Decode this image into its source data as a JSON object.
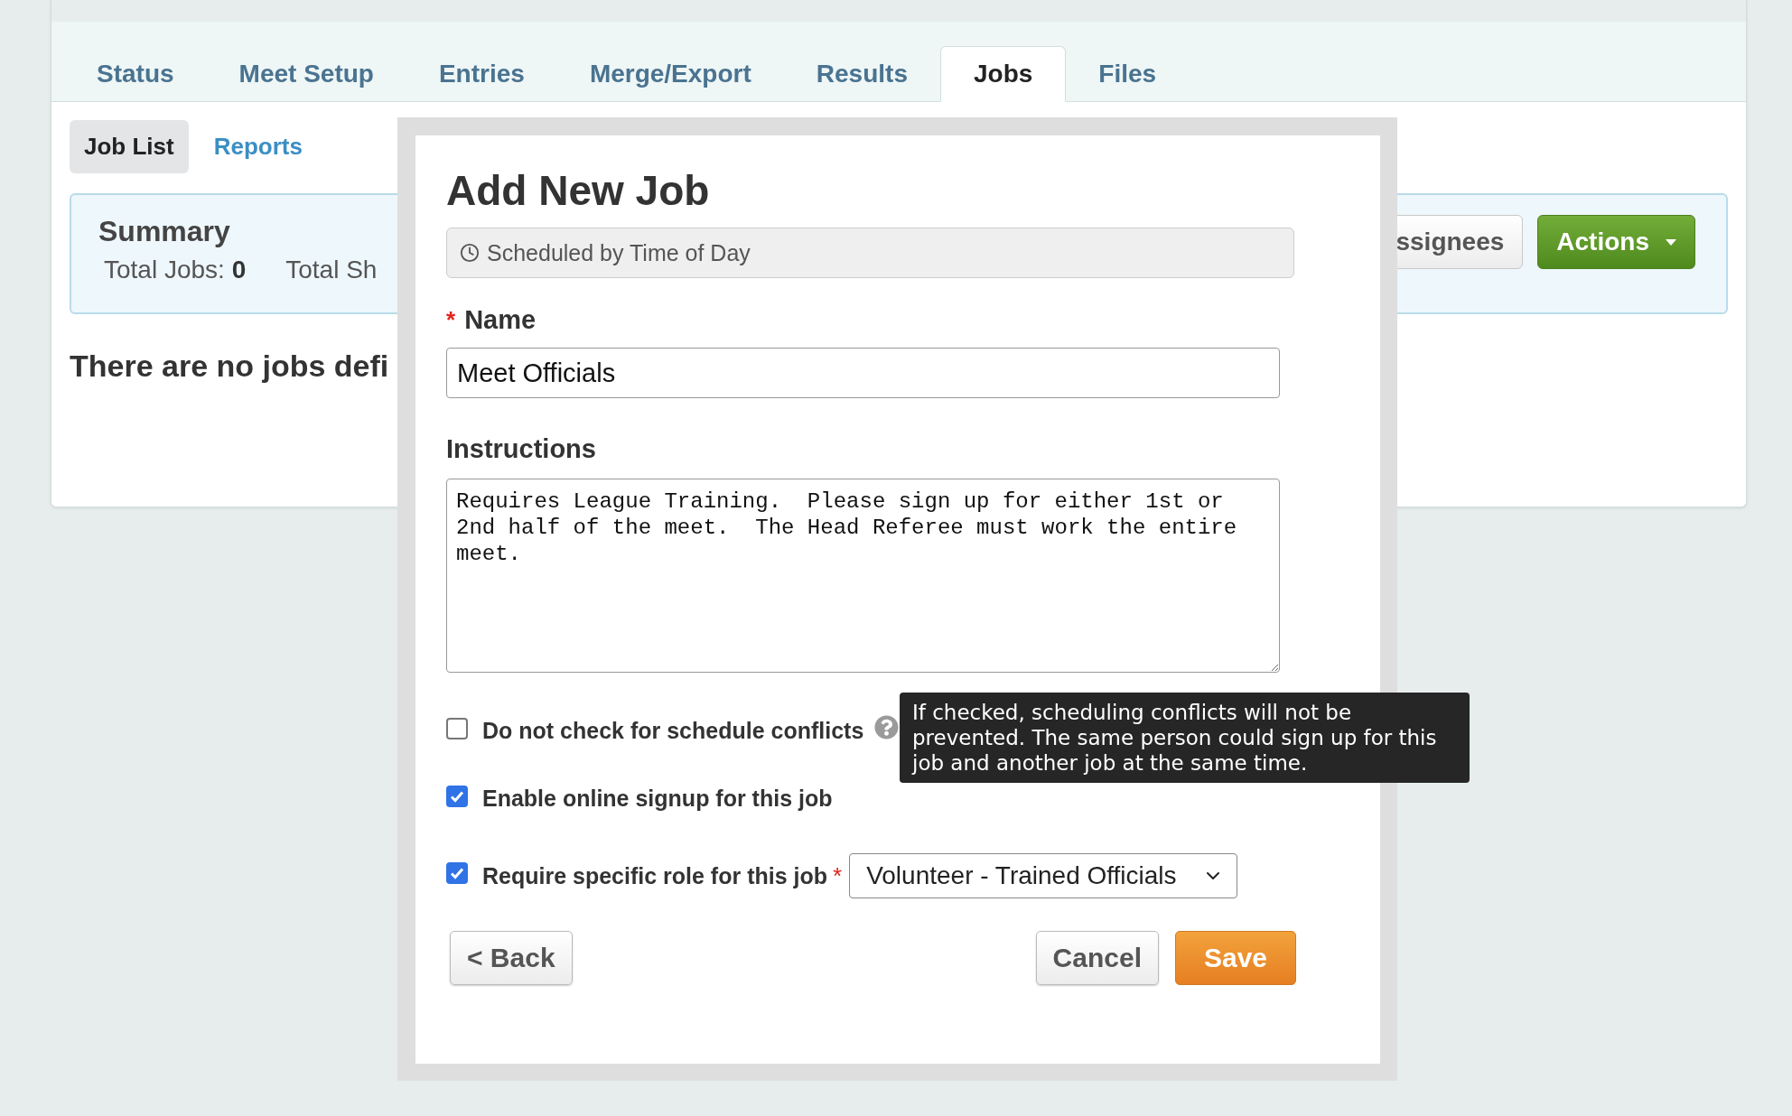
{
  "tabs": [
    {
      "label": "Status",
      "selected": false
    },
    {
      "label": "Meet Setup",
      "selected": false
    },
    {
      "label": "Entries",
      "selected": false
    },
    {
      "label": "Merge/Export",
      "selected": false
    },
    {
      "label": "Results",
      "selected": false
    },
    {
      "label": "Jobs",
      "selected": true
    },
    {
      "label": "Files",
      "selected": false
    }
  ],
  "subtabs": [
    {
      "label": "Job List",
      "selected": true
    },
    {
      "label": "Reports",
      "selected": false
    }
  ],
  "summary": {
    "title": "Summary",
    "stats": [
      "Total Jobs: **0**",
      "Total Sh"
    ]
  },
  "summary_buttons": [
    {
      "label": "ssignees",
      "kind": "plain"
    },
    {
      "label": "Actions",
      "kind": "primary"
    }
  ],
  "empty_message": "There are no jobs defi",
  "dialog": {
    "title": "Add New Job",
    "schedule_type": "Scheduled by Time of Day",
    "name_label": "Name",
    "required_mark": "*",
    "name_value": "Meet Officials",
    "instructions_label": "Instructions",
    "instructions_value": "Requires League Training.  Please sign up for either 1st or 2nd half of the meet.  The Head Referee must work the entire meet.",
    "options": [
      {
        "kind": "help",
        "label": "Do not check for schedule conflicts",
        "checked": false,
        "tooltip": "If checked, scheduling conflicts will not be prevented. The same person could sign up for this job and another job at the same time."
      },
      {
        "kind": "plain",
        "label": "Enable online signup for this job",
        "checked": true
      },
      {
        "kind": "select",
        "label": "Require specific role for this job",
        "checked": true,
        "required_mark": "*",
        "value": "Volunteer - Trained Officials"
      }
    ],
    "buttons": [
      {
        "label": "< Back",
        "kind": "plain"
      },
      {
        "label": "Cancel",
        "kind": "plain"
      },
      {
        "label": "Save",
        "kind": "primary"
      }
    ]
  }
}
